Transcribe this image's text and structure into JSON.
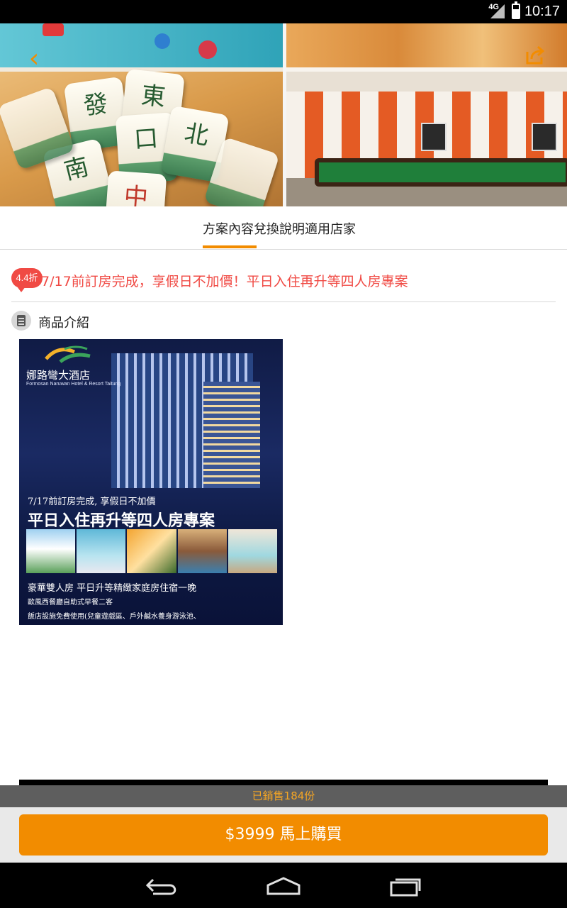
{
  "status_bar": {
    "network": "4G",
    "time": "10:17"
  },
  "hero": {
    "tile_chars": [
      "發",
      "口",
      "北",
      "南",
      "中"
    ]
  },
  "tabs": [
    {
      "label": "方案內容",
      "active": true
    },
    {
      "label": "兌換說明",
      "active": false
    },
    {
      "label": "適用店家",
      "active": false
    }
  ],
  "product": {
    "discount_badge": "4.4折",
    "title": "7/17前訂房完成，享假日不加價！平日入住再升等四人房專案"
  },
  "section": {
    "title": "商品介紹"
  },
  "promo_image": {
    "hotel_name": "娜路彎大酒店",
    "hotel_name_en": "Formosan Naruwan Hotel & Resort Taitung",
    "subtitle": "7/17前訂房完成, 享假日不加價",
    "headline": "平日入住再升等四人房專案",
    "line1": "豪華雙人房 平日升等精緻家庭房住宿一晚",
    "line2": "歐風西餐廳自助式早餐二客",
    "line3": "飯店設施免費使用(兒童遊戲區、戶外鹹水養身游泳池、"
  },
  "purchase": {
    "sold_text": "已銷售184份",
    "buy_label": "$3999 馬上購買"
  },
  "colors": {
    "accent": "#f28c00",
    "discount": "#f04a44"
  },
  "icons": [
    "back-arrow-icon",
    "share-icon",
    "document-icon",
    "nav-back-icon",
    "nav-home-icon",
    "nav-recent-icon"
  ]
}
